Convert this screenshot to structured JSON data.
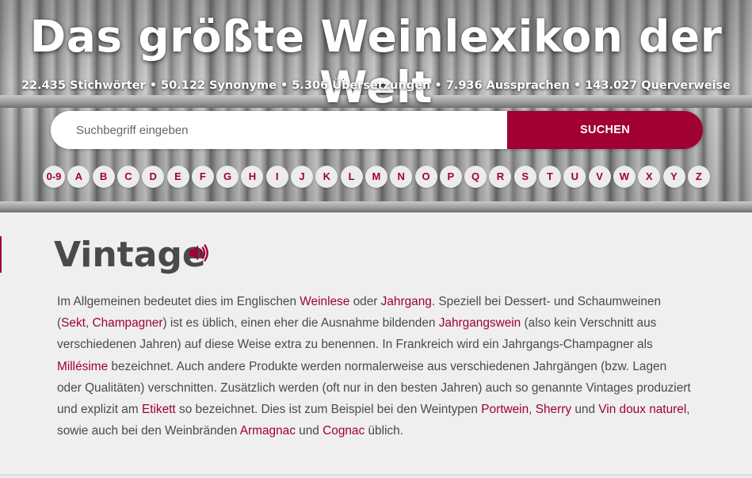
{
  "hero": {
    "title": "Das größte Weinlexikon der Welt",
    "stats": "22.435 Stichwörter • 50.122 Synonyme • 5.306 Übersetzungen • 7.936 Aussprachen • 143.027 Querverweise"
  },
  "search": {
    "placeholder": "Suchbegriff eingeben",
    "value": "",
    "button_label": "SUCHEN"
  },
  "alphabet": [
    "0-9",
    "A",
    "B",
    "C",
    "D",
    "E",
    "F",
    "G",
    "H",
    "I",
    "J",
    "K",
    "L",
    "M",
    "N",
    "O",
    "P",
    "Q",
    "R",
    "S",
    "T",
    "U",
    "V",
    "W",
    "X",
    "Y",
    "Z"
  ],
  "entry": {
    "title": "Vintage",
    "body": [
      {
        "t": "Im Allgemeinen bedeutet dies im Englischen "
      },
      {
        "t": "Weinlese",
        "link": true
      },
      {
        "t": " oder "
      },
      {
        "t": "Jahrgang",
        "link": true
      },
      {
        "t": ". Speziell bei Dessert- und Schaumweinen ("
      },
      {
        "t": "Sekt",
        "link": true
      },
      {
        "t": ", "
      },
      {
        "t": "Champagner",
        "link": true
      },
      {
        "t": ") ist es üblich, einen eher die Ausnahme bildenden "
      },
      {
        "t": "Jahrgangswein",
        "link": true
      },
      {
        "t": " (also kein Verschnitt aus verschiedenen Jahren) auf diese Weise extra zu benennen. In Frankreich wird ein Jahrgangs-Champagner als "
      },
      {
        "t": "Millésime",
        "link": true
      },
      {
        "t": " bezeichnet. Auch andere Produkte werden normalerweise aus verschiedenen Jahrgängen (bzw. Lagen oder Qualitäten) verschnitten. Zusätzlich werden (oft nur in den besten Jahren) auch so genannte Vintages produziert und explizit am "
      },
      {
        "t": "Etikett",
        "link": true
      },
      {
        "t": " so bezeichnet. Dies ist zum Beispiel bei den Weintypen "
      },
      {
        "t": "Portwein",
        "link": true
      },
      {
        "t": ", "
      },
      {
        "t": "Sherry",
        "link": true
      },
      {
        "t": " und "
      },
      {
        "t": "Vin doux naturel",
        "link": true
      },
      {
        "t": ", sowie auch bei den Weinbränden "
      },
      {
        "t": "Armagnac",
        "link": true
      },
      {
        "t": " und "
      },
      {
        "t": "Cognac",
        "link": true
      },
      {
        "t": " üblich."
      }
    ]
  },
  "colors": {
    "accent": "#a00032",
    "text": "#4a4a4a",
    "background": "#efefef"
  },
  "icons": {
    "pronunciation": "speaker-icon"
  }
}
